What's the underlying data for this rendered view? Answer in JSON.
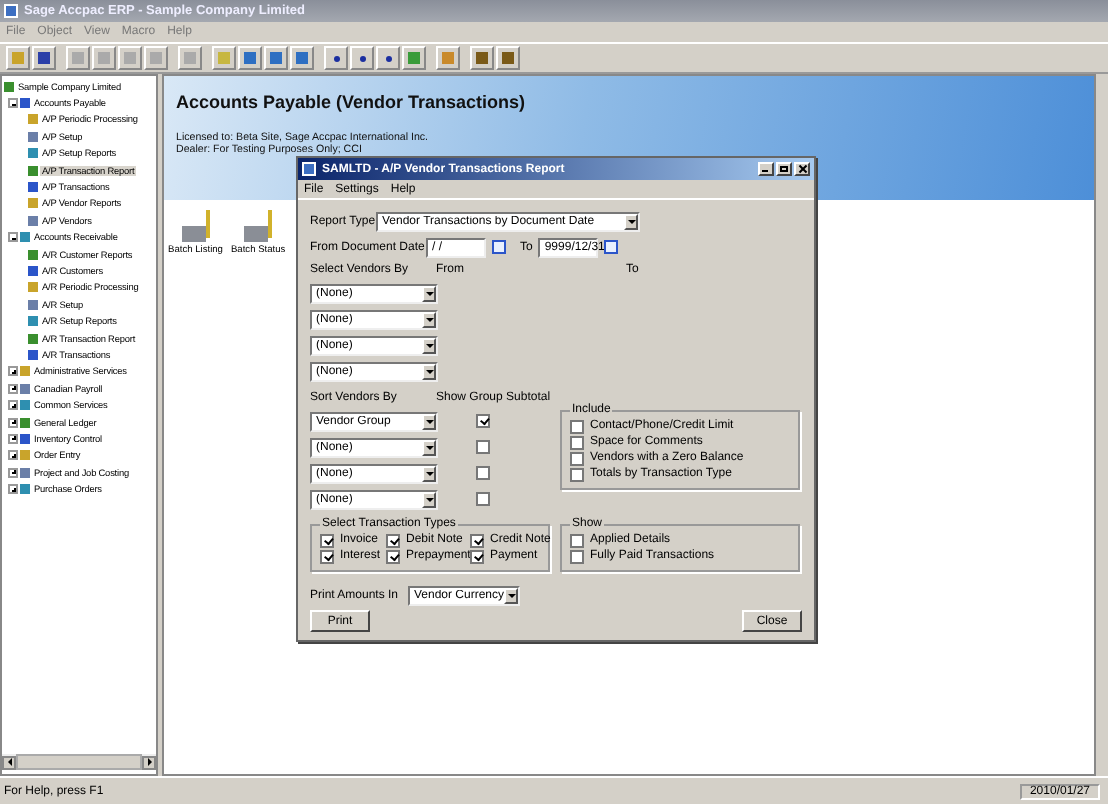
{
  "window": {
    "title": "Sage Accpac ERP - Sample Company Limited"
  },
  "menu": [
    "File",
    "Object",
    "View",
    "Macro",
    "Help"
  ],
  "tree": [
    {
      "label": "Sample Company Limited",
      "selected": false,
      "children": [
        {
          "label": "Accounts Payable",
          "selected": false,
          "expanded": true,
          "children": [
            {
              "label": "A/P Periodic Processing",
              "selected": false
            },
            {
              "label": "A/P Setup",
              "selected": false
            },
            {
              "label": "A/P Setup Reports",
              "selected": false
            },
            {
              "label": "A/P Transaction Report",
              "selected": true
            },
            {
              "label": "A/P Transactions",
              "selected": false
            },
            {
              "label": "A/P Vendor Reports",
              "selected": false
            },
            {
              "label": "A/P Vendors",
              "selected": false
            }
          ]
        },
        {
          "label": "Accounts Receivable",
          "selected": false,
          "expanded": true,
          "children": [
            {
              "label": "A/R Customer Reports",
              "selected": false
            },
            {
              "label": "A/R Customers",
              "selected": false
            },
            {
              "label": "A/R Periodic Processing",
              "selected": false
            },
            {
              "label": "A/R Setup",
              "selected": false
            },
            {
              "label": "A/R Setup Reports",
              "selected": false
            },
            {
              "label": "A/R Transaction Report",
              "selected": false
            },
            {
              "label": "A/R Transactions",
              "selected": false
            }
          ]
        },
        {
          "label": "Administrative Services",
          "selected": false,
          "expanded": false
        },
        {
          "label": "Canadian Payroll",
          "selected": false,
          "expanded": false
        },
        {
          "label": "Common Services",
          "selected": false,
          "expanded": false
        },
        {
          "label": "General Ledger",
          "selected": false,
          "expanded": false
        },
        {
          "label": "Inventory Control",
          "selected": false,
          "expanded": false
        },
        {
          "label": "Order Entry",
          "selected": false,
          "expanded": false
        },
        {
          "label": "Project and Job Costing",
          "selected": false,
          "expanded": false
        },
        {
          "label": "Purchase Orders",
          "selected": false,
          "expanded": false
        }
      ]
    }
  ],
  "header": {
    "title": "Accounts Payable (Vendor Transactions)",
    "license": "Licensed to: Beta Site, Sage Accpac International Inc.",
    "dealer": "Dealer: For Testing Purposes Only; CCI"
  },
  "shortcuts": [
    {
      "label": "Batch Listing"
    },
    {
      "label": "Batch Status"
    }
  ],
  "dialog": {
    "title": "SAMLTD - A/P Vendor Transactions Report",
    "menu": [
      "File",
      "Settings",
      "Help"
    ],
    "report_type": {
      "label": "Report Type",
      "value": "Vendor Transactions by Document Date"
    },
    "from_date": {
      "label": "From Document Date",
      "value": "/ /"
    },
    "to_date": {
      "label": "To",
      "value": "9999/12/31"
    },
    "select_vendors": {
      "label": "Select Vendors By",
      "from_label": "From",
      "to_label": "To",
      "rows": [
        "(None)",
        "(None)",
        "(None)",
        "(None)"
      ]
    },
    "sort_vendors": {
      "label": "Sort Vendors By",
      "subtotal_label": "Show Group Subtotal",
      "rows": [
        {
          "value": "Vendor Group",
          "checked": true
        },
        {
          "value": "(None)",
          "checked": false
        },
        {
          "value": "(None)",
          "checked": false
        },
        {
          "value": "(None)",
          "checked": false
        }
      ]
    },
    "include": {
      "title": "Include",
      "options": [
        {
          "label": "Contact/Phone/Credit Limit",
          "checked": false
        },
        {
          "label": "Space for Comments",
          "checked": false
        },
        {
          "label": "Vendors with a Zero Balance",
          "checked": false
        },
        {
          "label": "Totals by Transaction Type",
          "checked": false
        }
      ]
    },
    "transaction_types": {
      "title": "Select Transaction Types",
      "options": [
        {
          "label": "Invoice",
          "checked": true
        },
        {
          "label": "Debit Note",
          "checked": true
        },
        {
          "label": "Credit Note",
          "checked": true
        },
        {
          "label": "Interest",
          "checked": true
        },
        {
          "label": "Prepayment",
          "checked": true
        },
        {
          "label": "Payment",
          "checked": true
        }
      ]
    },
    "show": {
      "title": "Show",
      "options": [
        {
          "label": "Applied Details",
          "checked": false
        },
        {
          "label": "Fully Paid Transactions",
          "checked": false
        }
      ]
    },
    "print_amounts": {
      "label": "Print Amounts In",
      "value": "Vendor Currency"
    },
    "buttons": [
      "Print",
      "Close"
    ]
  },
  "status_bar": {
    "help": "For Help, press F1",
    "date": "2010/01/27"
  }
}
